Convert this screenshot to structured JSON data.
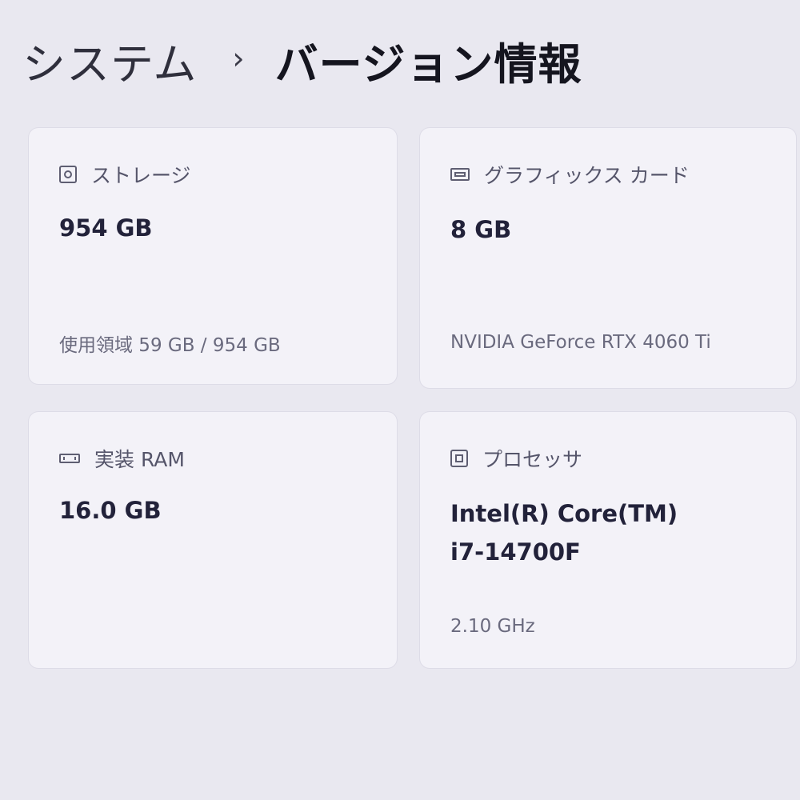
{
  "breadcrumb": {
    "root": "システム",
    "separator": "›",
    "current": "バージョン情報"
  },
  "cards": {
    "storage": {
      "icon": "storage-icon",
      "title": "ストレージ",
      "value": "954 GB",
      "detail": "使用領域 59 GB / 954 GB"
    },
    "graphics": {
      "icon": "graphics-card-icon",
      "title": "グラフィックス カード",
      "value": "8 GB",
      "detail": "NVIDIA GeForce RTX 4060 Ti"
    },
    "ram": {
      "icon": "memory-icon",
      "title": "実装 RAM",
      "value": "16.0 GB"
    },
    "processor": {
      "icon": "processor-icon",
      "title": "プロセッサ",
      "value_line1": "Intel(R) Core(TM)",
      "value_line2": "i7-14700F",
      "detail": "2.10 GHz"
    }
  }
}
